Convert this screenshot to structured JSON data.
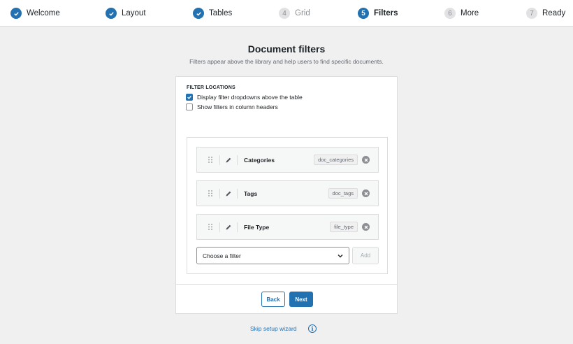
{
  "steps": [
    {
      "label": "Welcome",
      "state": "done"
    },
    {
      "label": "Layout",
      "state": "done"
    },
    {
      "label": "Tables",
      "state": "done"
    },
    {
      "number": "4",
      "label": "Grid",
      "state": "todo"
    },
    {
      "number": "5",
      "label": "Filters",
      "state": "current"
    },
    {
      "number": "6",
      "label": "More",
      "state": "todo"
    },
    {
      "number": "7",
      "label": "Ready",
      "state": "todo"
    }
  ],
  "page": {
    "title": "Document filters",
    "subtitle": "Filters appear above the library and help users to find specific documents."
  },
  "locations": {
    "label": "FILTER LOCATIONS",
    "options": [
      {
        "label": "Display filter dropdowns above the table",
        "checked": true
      },
      {
        "label": "Show filters in column headers",
        "checked": false
      }
    ]
  },
  "filters": [
    {
      "name": "Categories",
      "slug": "doc_categories"
    },
    {
      "name": "Tags",
      "slug": "doc_tags"
    },
    {
      "name": "File Type",
      "slug": "file_type"
    }
  ],
  "add_filter": {
    "select_value": "Choose a filter",
    "add_label": "Add"
  },
  "footer": {
    "back_label": "Back",
    "next_label": "Next"
  },
  "skip_label": "Skip setup wizard",
  "colors": {
    "accent": "#2271b1",
    "background": "#f0f0f1"
  }
}
